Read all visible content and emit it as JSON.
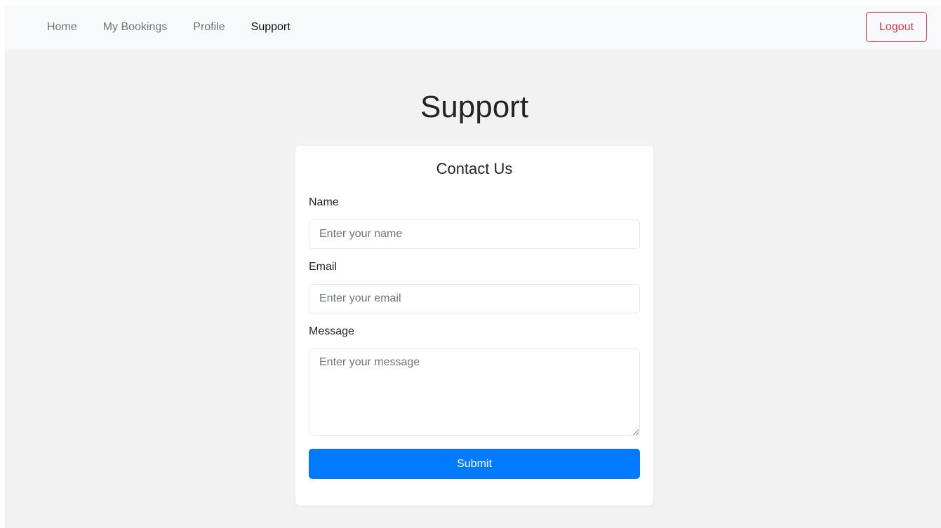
{
  "nav": {
    "links": [
      {
        "label": "Home",
        "active": false
      },
      {
        "label": "My Bookings",
        "active": false
      },
      {
        "label": "Profile",
        "active": false
      },
      {
        "label": "Support",
        "active": true
      }
    ],
    "logout_label": "Logout"
  },
  "page": {
    "title": "Support"
  },
  "contact_form": {
    "title": "Contact Us",
    "name": {
      "label": "Name",
      "placeholder": "Enter your name",
      "value": ""
    },
    "email": {
      "label": "Email",
      "placeholder": "Enter your email",
      "value": ""
    },
    "message": {
      "label": "Message",
      "placeholder": "Enter your message",
      "value": ""
    },
    "submit_label": "Submit"
  },
  "colors": {
    "primary": "#007bff",
    "danger": "#dc3545",
    "background": "#f2f2f2",
    "navbar": "#f8f9fa"
  }
}
